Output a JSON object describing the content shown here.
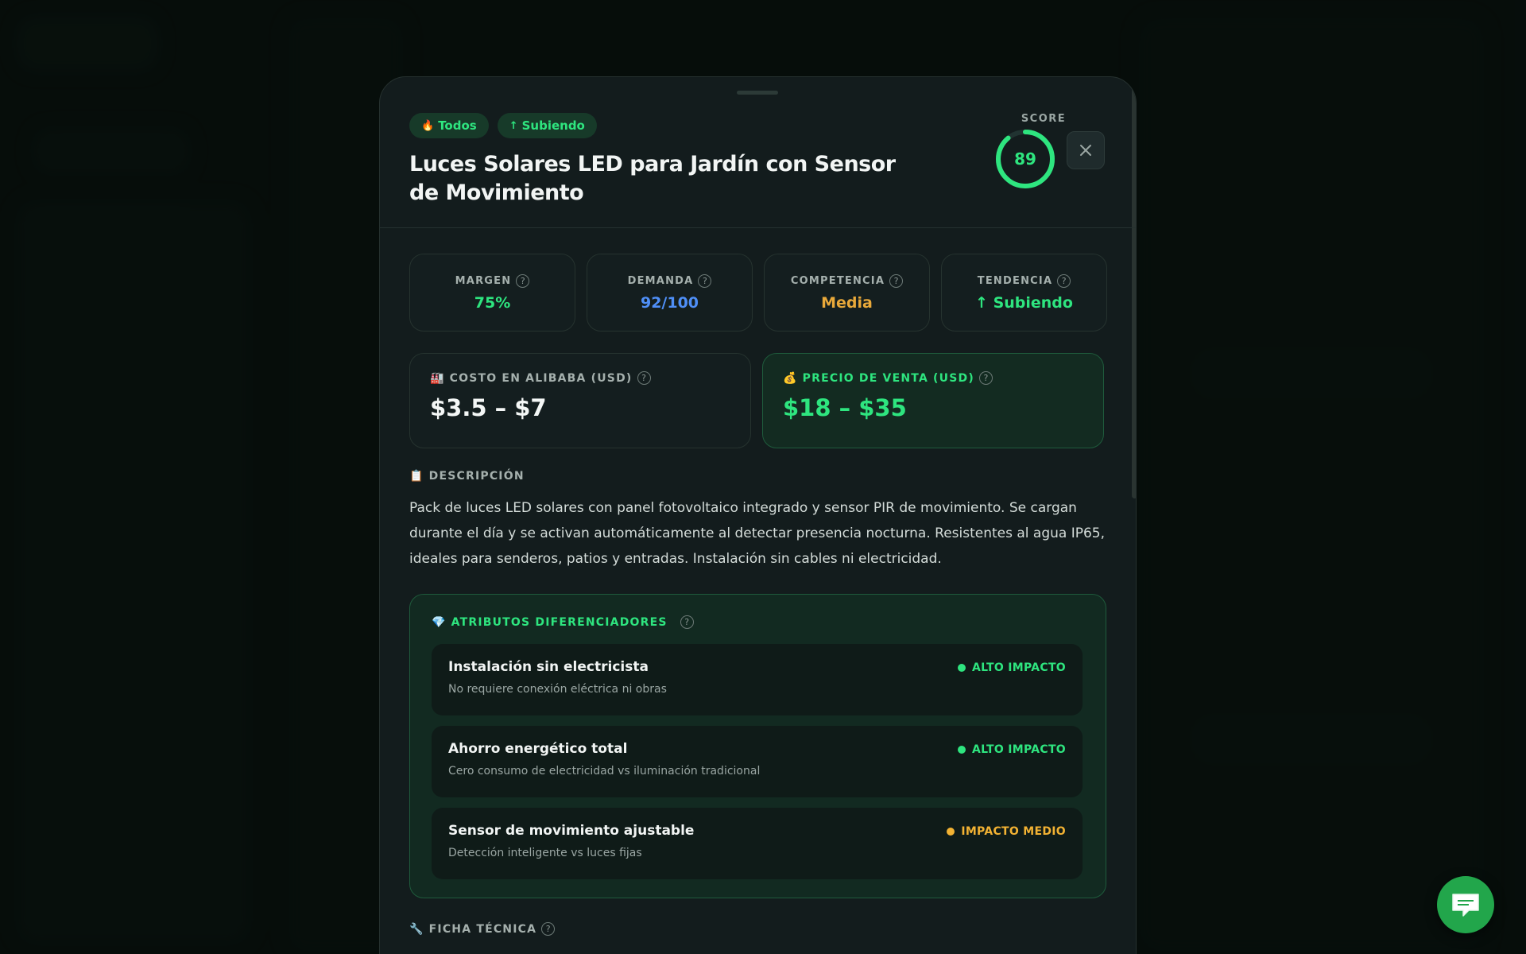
{
  "modal": {
    "tags": [
      {
        "icon": "🔥",
        "label": "Todos"
      },
      {
        "icon": "↑",
        "label": "Subiendo"
      }
    ],
    "title": "Luces Solares LED para Jardín con Sensor de Movimiento",
    "score": {
      "label": "SCORE",
      "value": "89",
      "fraction": 0.89
    }
  },
  "metrics": [
    {
      "label": "MARGEN",
      "value": "75%",
      "color": "#2ee57f"
    },
    {
      "label": "DEMANDA",
      "value": "92/100",
      "color": "#4f8ff7"
    },
    {
      "label": "COMPETENCIA",
      "value": "Media",
      "color": "#e9a93a"
    },
    {
      "label": "TENDENCIA",
      "value": "↑ Subiendo",
      "color": "#2ee57f"
    }
  ],
  "prices": {
    "cost": {
      "icon": "🏭",
      "label": "COSTO EN ALIBABA (USD)",
      "value": "$3.5 – $7"
    },
    "sale": {
      "icon": "💰",
      "label": "PRECIO DE VENTA (USD)",
      "value": "$18 – $35"
    }
  },
  "description": {
    "icon": "📋",
    "label": "DESCRIPCIÓN",
    "text": "Pack de luces LED solares con panel fotovoltaico integrado y sensor PIR de movimiento. Se cargan durante el día y se activan automáticamente al detectar presencia nocturna. Resistentes al agua IP65, ideales para senderos, patios y entradas. Instalación sin cables ni electricidad."
  },
  "attributes": {
    "icon": "💎",
    "label": "ATRIBUTOS DIFERENCIADORES",
    "items": [
      {
        "name": "Instalación sin electricista",
        "sub": "No requiere conexión eléctrica ni obras",
        "impact": "ALTO IMPACTO",
        "color": "#2ee57f"
      },
      {
        "name": "Ahorro energético total",
        "sub": "Cero consumo de electricidad vs iluminación tradicional",
        "impact": "ALTO IMPACTO",
        "color": "#2ee57f"
      },
      {
        "name": "Sensor de movimiento ajustable",
        "sub": "Detección inteligente vs luces fijas",
        "impact": "IMPACTO MEDIO",
        "color": "#f2b233"
      }
    ]
  },
  "ficha": {
    "icon": "🔧",
    "label": "FICHA TÉCNICA"
  },
  "help_glyph": "?",
  "colors": {
    "accent": "#2ee57f",
    "background": "#0a1410",
    "modal": "#131c1d"
  }
}
